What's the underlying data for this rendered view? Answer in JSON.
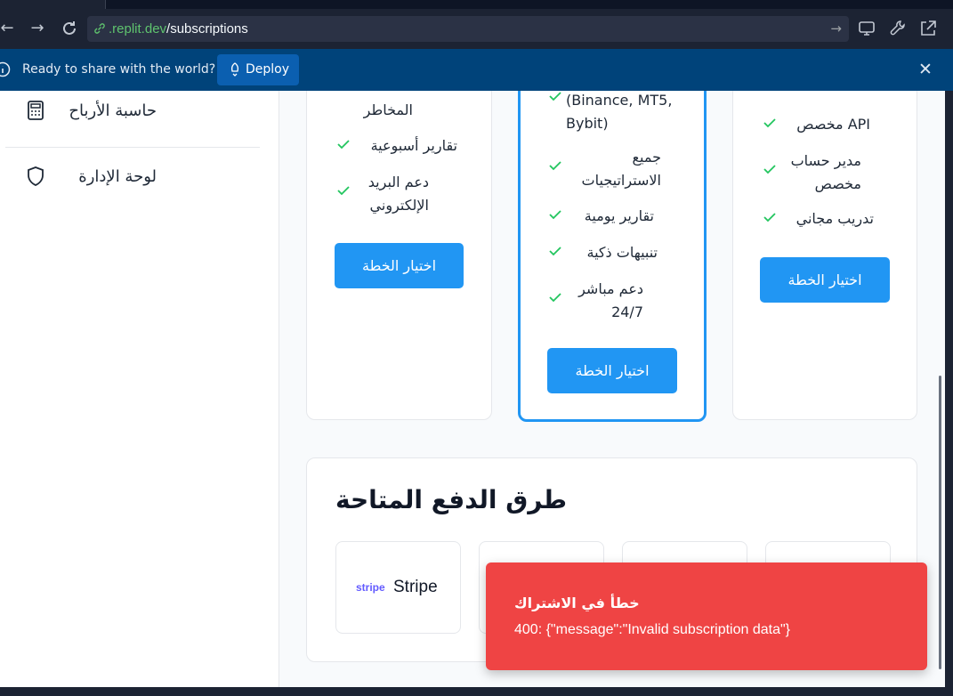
{
  "browser": {
    "url_host": ".replit.dev",
    "url_path": "/subscriptions",
    "back_icon": "arrow-left-icon",
    "forward_icon": "arrow-right-icon",
    "reload_icon": "reload-icon"
  },
  "banner": {
    "text": "Ready to share with the world?",
    "deploy_label": "Deploy",
    "close": "✕"
  },
  "sidebar": {
    "items": [
      {
        "label": "حاسبة الأرباح",
        "icon": "calculator-icon"
      },
      {
        "label": "لوحة الإدارة",
        "icon": "shield-icon"
      }
    ]
  },
  "plans": [
    {
      "features": [
        "المخاطر",
        "تقارير أسبوعية",
        "دعم البريد الإلكتروني"
      ],
      "button": "اختيار الخطة"
    },
    {
      "features": [
        "(Binance, MT5, Bybit)",
        "جميع الاستراتيجيات",
        "تقارير يومية",
        "تنبيهات ذكية",
        "دعم مباشر 24/7"
      ],
      "button": "اختيار الخطة"
    },
    {
      "features": [
        "API مخصص",
        "مدير حساب مخصص",
        "تدريب مجاني"
      ],
      "button": "اختيار الخطة"
    }
  ],
  "payments": {
    "title": "طرق الدفع المتاحة",
    "methods": [
      {
        "logo": "stripe",
        "name": "Stripe"
      }
    ]
  },
  "toast": {
    "title": "خطأ في الاشتراك",
    "message": "400: {\"message\":\"Invalid subscription data\"}"
  },
  "colors": {
    "accent": "#2196f3",
    "check": "#22c55e",
    "toast_bg": "#ef4444",
    "banner_bg": "#00437a"
  }
}
